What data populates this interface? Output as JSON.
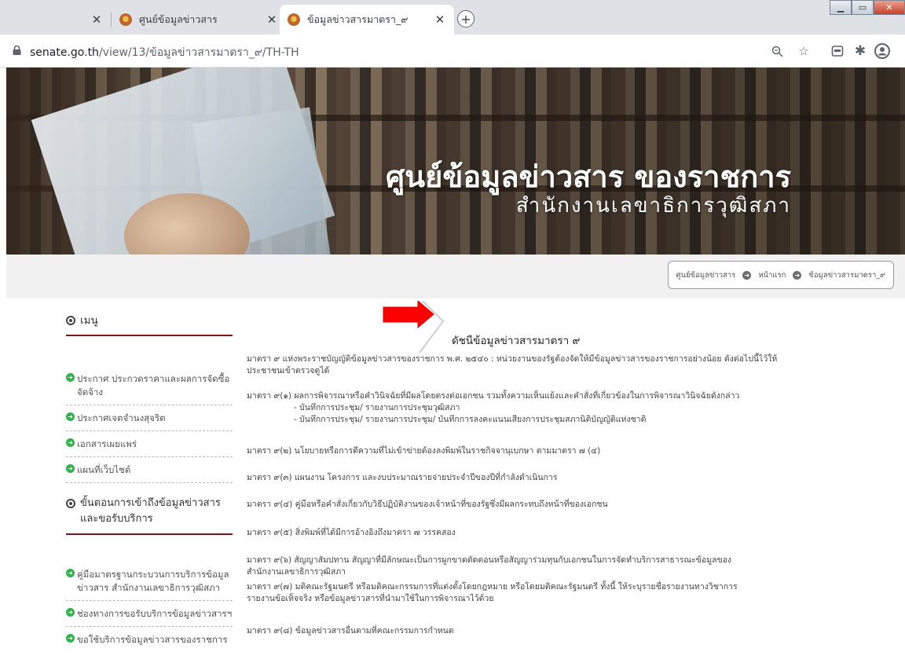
{
  "browser": {
    "tabs": [
      {
        "title": ""
      },
      {
        "title": "ศูนย์ข้อมูลข่าวสาร"
      },
      {
        "title": "ข้อมูลข่าวสารมาตรา_๙"
      }
    ],
    "url_host": "senate.go.th",
    "url_path": "/view/13/ข้อมูลข่าวสารมาตรา_๙/TH-TH",
    "icons": [
      "lock-icon",
      "zoom-icon",
      "star-icon",
      "extension-icon",
      "puzzle-icon",
      "profile-icon"
    ]
  },
  "hero": {
    "title": "ศูนย์ข้อมูลข่าวสาร ของราชการ",
    "subtitle": "สำนักงานเลขาธิการวุฒิสภา"
  },
  "breadcrumb": [
    "ศูนย์ข้อมูลข่าวสาร",
    "หน้าแรก",
    "ข้อมูลข่าวสารมาตรา_๙"
  ],
  "sidebar": {
    "menu_heading": "เมนู",
    "menu_items": [
      "ประกาศ ประกวดราคาและผลการจัดซื้อจัดจ้าง",
      "ประกาศเจตจำนงสุจริต",
      "เอกสารเผยแพร่",
      "แผนที่เว็บไซต์"
    ],
    "steps_heading": "ขั้นตอนการเข้าถึงข้อมูลข่าวสารและขอรับบริการ",
    "steps_items": [
      "คู่มือมาตรฐานกระบวนการบริการข้อมูลข่าวสาร สำนักงานเลขาธิการวุฒิสภา",
      "ช่องทางการขอรับบริการข้อมูลข่าวสารฯ",
      "ขอใช้บริการข้อมูลข่าวสารของราชการ"
    ]
  },
  "content": {
    "title": "ดัชนีข้อมูลข่าวสารมาตรา ๙",
    "intro": "มาตรา ๙ แห่งพระราชบัญญัติข้อมูลข่าวสารของราชการ พ.ศ. ๒๕๔๐ : หน่วยงานของรัฐต้องจัดให้มีข้อมูลข่าวสารของราชการอย่างน้อย ดังต่อไปนี้ไว้ให้ประชาชนเข้าตรวจดูได้",
    "s1": "มาตรา ๙(๑) ผลการพิจารณาหรือคำวินิจฉัยที่มีผลโดยตรงต่อเอกชน รวมทั้งความเห็นแย้งและคำสั่งที่เกี่ยวข้องในการพิจารณาวินิจฉัยดังกล่าว",
    "s1a": "- บันทึกการประชุม/ รายงานการประชุมวุฒิสภา",
    "s1b": "- บันทึกการประชุม/ รายงานการประชุม/ บันทึกการลงคะแนนเสียงการประชุมสภานิติบัญญัติแห่งชาติ",
    "s2": "มาตรา ๙(๒) นโยบายหรือการตีความที่ไม่เข้าข่ายต้องลงพิมพ์ในราชกิจจานุเบกษา ตามมาตรา ๗ (๔)",
    "s3": "มาตรา ๙(๓) แผนงาน โครงการ และงบประมาณรายจ่ายประจำปีของปีที่กำลังดำเนินการ",
    "s4": "มาตรา ๙(๔) คู่มือหรือคำสั่งเกี่ยวกับวิธีปฏิบัติงานของเจ้าหน้าที่ของรัฐซึ่งมีผลกระทบถึงหน้าที่ของเอกชน",
    "s5": "มาตรา ๙(๕) สิ่งพิมพ์ที่ได้มีการอ้างอิงถึงมาตรา ๗ วรรคสอง",
    "s6": "มาตรา ๙(๖) สัญญาสัมปทาน สัญญาที่มีลักษณะเป็นการผูกขาดตัดตอนหรือสัญญาร่วมทุนกับเอกชนในการจัดทำบริการสาธารณะข้อมูลของสำนักงานเลขาธิการวุฒิสภา",
    "s7": "มาตรา ๙(๗) มติคณะรัฐมนตรี หรือมติคณะกรรมการที่แต่งตั้งโดยกฎหมาย หรือโดยมติคณะรัฐมนตรี ทั้งนี้ ให้ระบุรายชื่อรายงานทางวิชาการ รายงานข้อเท็จจริง หรือข้อมูลข่าวสารที่นำมาใช้ในการพิจารณาไว้ด้วย",
    "s8": "มาตรา ๙(๘) ข้อมูลข่าวสารอื่นตามที่คณะกรรมการกำหนด"
  },
  "colors": {
    "accent_dark_red": "#7d1818",
    "bullet_green": "#2fb24a",
    "annotation_arrow": "#ff0000"
  }
}
